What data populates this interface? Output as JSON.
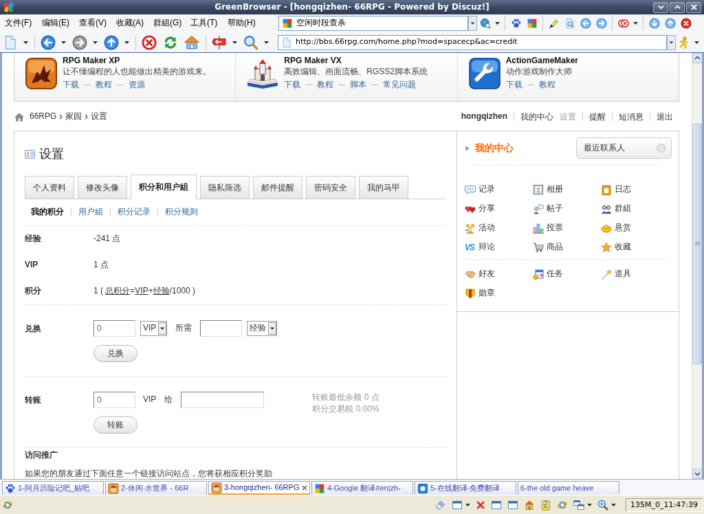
{
  "window": {
    "title": "GreenBrowser - [hongqizhen- 66RPG - Powered by Discuz!]"
  },
  "menu": [
    "文件(F)",
    "编辑(E)",
    "查看(V)",
    "收藏(A)",
    "群組(G)",
    "工具(T)",
    "帮助(H)"
  ],
  "search": {
    "value": "空闲时段查杀"
  },
  "address": {
    "value": "http://bbs.66rpg.com/home.php?mod=spacecp&ac=credit"
  },
  "products": [
    {
      "title": "RPG Maker XP",
      "subtitle": "让不懂编程的人也能做出精美的游戏来。",
      "links": [
        "下载",
        "教程",
        "资源"
      ]
    },
    {
      "title": "RPG Maker VX",
      "subtitle": "高效编辑、画面流畅、RGSS2脚本系统",
      "links": [
        "下载",
        "教程",
        "脚本",
        "常见问题"
      ]
    },
    {
      "title": "ActionGameMaker",
      "subtitle": "动作游戏制作大师",
      "links": [
        "下载",
        "教程"
      ]
    }
  ],
  "breadcrumb": [
    "66RPG",
    "家园",
    "设置"
  ],
  "user_nav": {
    "username": "hongqizhen",
    "items": [
      {
        "label": "我的中心",
        "selected": false
      },
      {
        "label": "设置",
        "selected": true
      },
      {
        "label": "提醒",
        "selected": false
      },
      {
        "label": "短消息",
        "selected": false
      },
      {
        "label": "退出",
        "selected": false
      }
    ]
  },
  "page": {
    "title": "设置",
    "tabs": [
      {
        "label": "个人资料",
        "selected": false
      },
      {
        "label": "修改头像",
        "selected": false
      },
      {
        "label": "积分和用户組",
        "selected": true
      },
      {
        "label": "隐私筛选",
        "selected": false
      },
      {
        "label": "邮件提醒",
        "selected": false
      },
      {
        "label": "密码安全",
        "selected": false
      },
      {
        "label": "我的马甲",
        "selected": false
      }
    ],
    "subnav": [
      {
        "label": "我的积分",
        "selected": true
      },
      {
        "label": "用户組",
        "selected": false
      },
      {
        "label": "积分记录",
        "selected": false
      },
      {
        "label": "积分规则",
        "selected": false
      }
    ],
    "credits": [
      {
        "label": "经验",
        "value": "-241 点"
      },
      {
        "label": "VIP",
        "value": "1 点"
      },
      {
        "label": "积分",
        "segments": [
          {
            "text": "1 ( ",
            "kind": "plain"
          },
          {
            "text": "总积分",
            "kind": "term"
          },
          {
            "text": "=",
            "kind": "plain"
          },
          {
            "text": "VIP",
            "kind": "term"
          },
          {
            "text": "+",
            "kind": "plain"
          },
          {
            "text": "经验",
            "kind": "term"
          },
          {
            "text": "/1000 )",
            "kind": "plain"
          }
        ]
      }
    ],
    "exchange": {
      "label": "兑换",
      "amount": "0",
      "from_unit": "VIP",
      "cost_label": "所需",
      "to_unit": "经验",
      "button": "兑换"
    },
    "transfer": {
      "label": "转账",
      "amount": "0",
      "unit": "VIP",
      "recipient_label": "给",
      "notes": [
        "转账最低余额 0 点",
        "积分交易税 0.00%"
      ],
      "button": "转账"
    },
    "promotion": {
      "title": "访问推广",
      "text": "如果您的朋友通过下面任意一个链接访问站点，您将获相应积分奖励"
    }
  },
  "sidebar": {
    "title": "我的中心",
    "contacts_button": "最近联系人",
    "groups": [
      [
        {
          "label": "记录"
        },
        {
          "label": "相册"
        },
        {
          "label": "日志"
        },
        {
          "label": "分享"
        },
        {
          "label": "帖子"
        },
        {
          "label": "群組"
        },
        {
          "label": "活动"
        },
        {
          "label": "投票"
        },
        {
          "label": "悬赏"
        },
        {
          "label": "辩论",
          "icon_text": "VS"
        },
        {
          "label": "商品"
        },
        {
          "label": "收藏"
        }
      ],
      [
        {
          "label": "好友"
        },
        {
          "label": "任务"
        },
        {
          "label": "道具"
        },
        {
          "label": "勋章"
        }
      ]
    ]
  },
  "browser_tabs": [
    {
      "label": "1-阿月历险记吧_贴吧",
      "selected": false
    },
    {
      "label": "2-休闲·水世界 - 66R",
      "selected": false
    },
    {
      "label": "3-hongqizhen- 66RPG",
      "selected": true
    },
    {
      "label": "4-Google 翻译#en|zh-",
      "selected": false
    },
    {
      "label": "5-在线翻译-免费翻译",
      "selected": false
    },
    {
      "label": "6-the old game heave",
      "selected": false
    }
  ],
  "status_bar": {
    "memory_clock": "135M_0_11:47:39"
  }
}
